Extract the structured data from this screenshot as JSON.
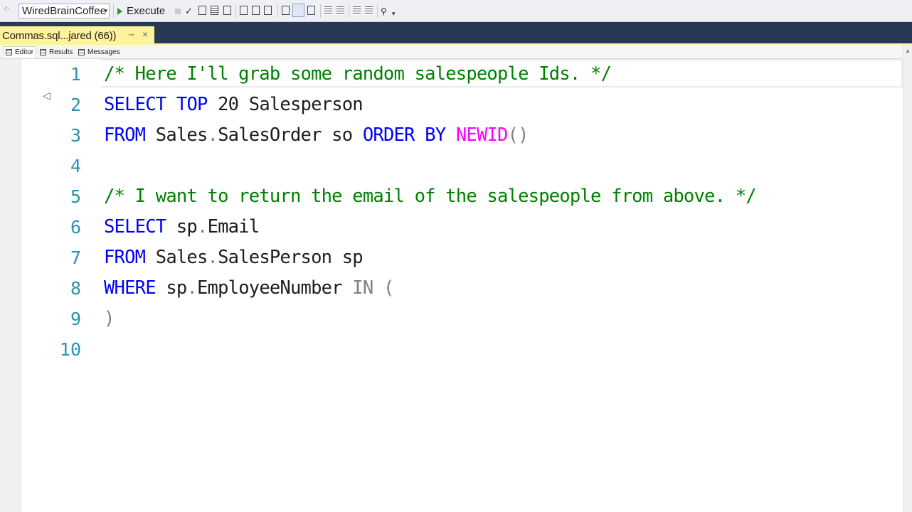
{
  "toolbar": {
    "database": "WiredBrainCoffee",
    "execute_label": "Execute",
    "icons": [
      "parse-check-icon",
      "display-estimated-plan-icon",
      "query-options-icon",
      "intellisense-icon",
      "include-plan-icon",
      "live-stats-icon",
      "client-stats-icon",
      "results-to-text-icon",
      "results-to-grid-icon",
      "results-to-file-icon",
      "comment-icon",
      "uncomment-icon",
      "decrease-indent-icon",
      "increase-indent-icon",
      "specify-values-icon"
    ]
  },
  "document_tab": {
    "title": "Commas.sql...jared (66))",
    "pin_glyph": "⊸",
    "close_glyph": "×",
    "color": "#fff29d"
  },
  "subtabs": [
    {
      "label": "Editor",
      "active": true
    },
    {
      "label": "Results",
      "active": false
    },
    {
      "label": "Messages",
      "active": false
    }
  ],
  "editor": {
    "line_numbers": [
      "1",
      "2",
      "3",
      "4",
      "5",
      "6",
      "7",
      "8",
      "9",
      "10"
    ],
    "colors": {
      "keyword": "#0000ff",
      "comment": "#008000",
      "function": "#ff00ff",
      "operator": "#808080",
      "line_number": "#2b91af"
    },
    "lines": [
      [
        {
          "t": "/* Here I'll grab some random salespeople Ids. */",
          "c": "cm"
        }
      ],
      [
        {
          "t": "SELECT",
          "c": "kw"
        },
        {
          "t": " "
        },
        {
          "t": "TOP",
          "c": "kw"
        },
        {
          "t": " 20 Salesperson"
        }
      ],
      [
        {
          "t": "FROM",
          "c": "kw"
        },
        {
          "t": " Sales"
        },
        {
          "t": ".",
          "c": "gr"
        },
        {
          "t": "SalesOrder so "
        },
        {
          "t": "ORDER",
          "c": "kw"
        },
        {
          "t": " "
        },
        {
          "t": "BY",
          "c": "kw"
        },
        {
          "t": " "
        },
        {
          "t": "NEWID",
          "c": "fn"
        },
        {
          "t": "()",
          "c": "gr"
        }
      ],
      [],
      [
        {
          "t": "/* I want to return the email of the salespeople from above. */",
          "c": "cm"
        }
      ],
      [
        {
          "t": "SELECT",
          "c": "kw"
        },
        {
          "t": " sp"
        },
        {
          "t": ".",
          "c": "gr"
        },
        {
          "t": "Email"
        }
      ],
      [
        {
          "t": "FROM",
          "c": "kw"
        },
        {
          "t": " Sales"
        },
        {
          "t": ".",
          "c": "gr"
        },
        {
          "t": "SalesPerson sp"
        }
      ],
      [
        {
          "t": "WHERE",
          "c": "kw"
        },
        {
          "t": " sp"
        },
        {
          "t": ".",
          "c": "gr"
        },
        {
          "t": "EmployeeNumber "
        },
        {
          "t": "IN",
          "c": "gr"
        },
        {
          "t": " "
        },
        {
          "t": "(",
          "c": "gr"
        }
      ],
      [
        {
          "t": ")",
          "c": "gr"
        }
      ],
      []
    ]
  }
}
